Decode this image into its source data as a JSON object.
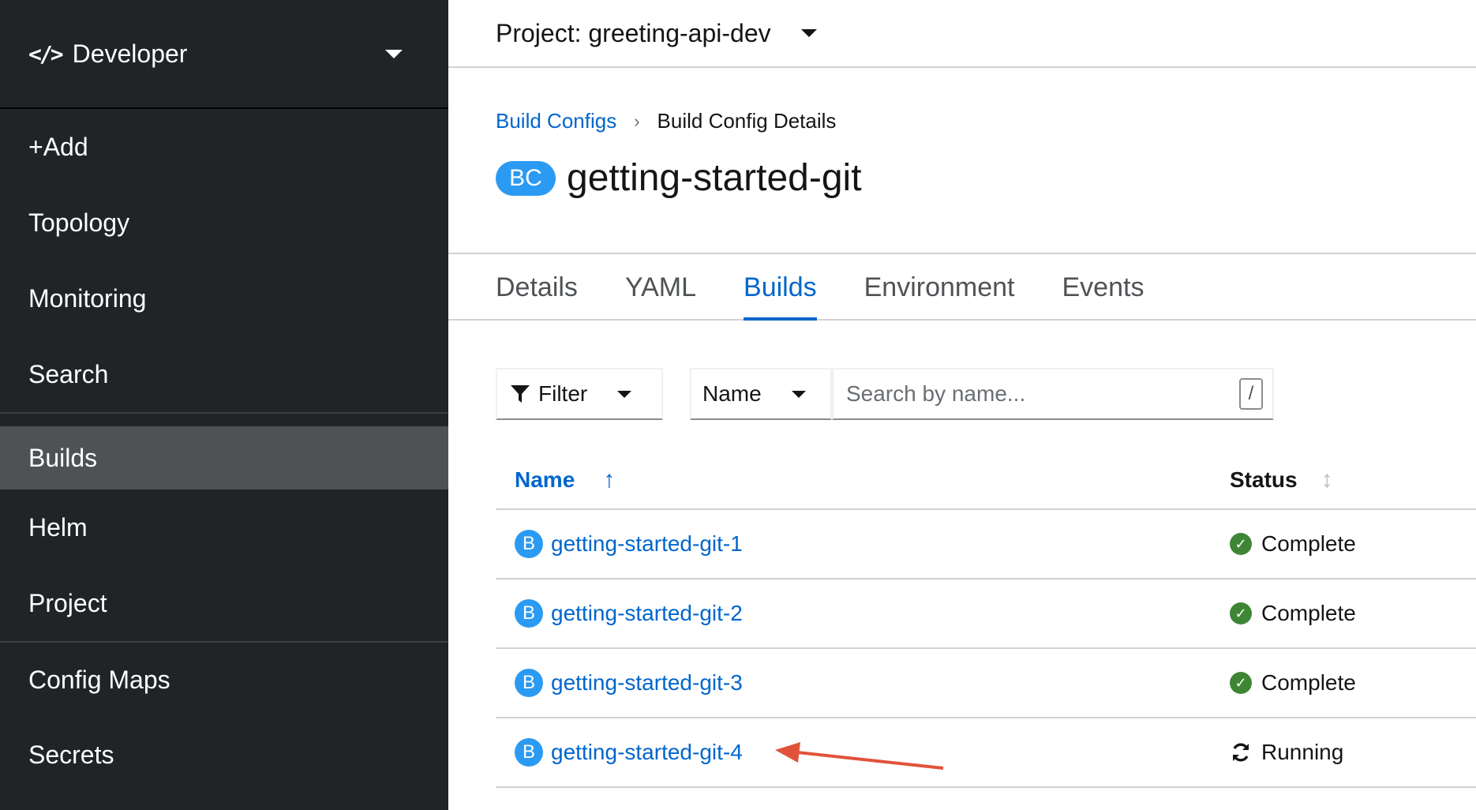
{
  "sidebar": {
    "perspective": {
      "icon": "code-icon",
      "icon_glyph": "</>",
      "label": "Developer"
    },
    "group1": [
      {
        "label": "+Add"
      },
      {
        "label": "Topology"
      },
      {
        "label": "Monitoring"
      },
      {
        "label": "Search"
      }
    ],
    "group2": [
      {
        "label": "Builds",
        "active": true
      },
      {
        "label": "Helm"
      },
      {
        "label": "Project"
      }
    ],
    "group3": [
      {
        "label": "Config Maps"
      },
      {
        "label": "Secrets"
      }
    ]
  },
  "project": {
    "label": "Project: greeting-api-dev"
  },
  "breadcrumb": {
    "parent": "Build Configs",
    "separator": "›",
    "current": "Build Config Details"
  },
  "header": {
    "badge": "BC",
    "title": "getting-started-git"
  },
  "tabs": [
    {
      "label": "Details"
    },
    {
      "label": "YAML"
    },
    {
      "label": "Builds",
      "active": true
    },
    {
      "label": "Environment"
    },
    {
      "label": "Events"
    }
  ],
  "toolbar": {
    "filter_label": "Filter",
    "name_select_value": "Name",
    "search_placeholder": "Search by name...",
    "search_shortcut": "/"
  },
  "table": {
    "columns": {
      "name": "Name",
      "name_sort": "↑",
      "status": "Status",
      "status_sort": "↕"
    },
    "rows": [
      {
        "badge": "B",
        "name": "getting-started-git-1",
        "status": "Complete",
        "status_icon": "check-circle-icon"
      },
      {
        "badge": "B",
        "name": "getting-started-git-2",
        "status": "Complete",
        "status_icon": "check-circle-icon"
      },
      {
        "badge": "B",
        "name": "getting-started-git-3",
        "status": "Complete",
        "status_icon": "check-circle-icon"
      },
      {
        "badge": "B",
        "name": "getting-started-git-4",
        "status": "Running",
        "status_icon": "sync-icon"
      }
    ]
  },
  "colors": {
    "sidebar_bg": "#212427",
    "active_nav_bg": "#4f5255",
    "link_blue": "#0066cc",
    "badge_blue": "#2b9af3",
    "success_green": "#3e8635",
    "annotation_arrow": "#e0533a"
  }
}
